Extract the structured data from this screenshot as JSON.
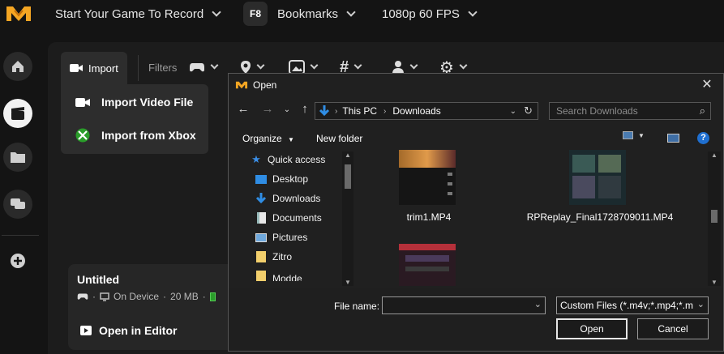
{
  "topbar": {
    "game_selector": "Start Your Game To Record",
    "hotkey": "F8",
    "bookmarks": "Bookmarks",
    "quality": "1080p 60 FPS"
  },
  "toolbar": {
    "import_label": "Import",
    "filters_label": "Filters"
  },
  "import_menu": {
    "items": [
      {
        "label": "Import Video File"
      },
      {
        "label": "Import from Xbox"
      }
    ]
  },
  "card": {
    "title": "Untitled",
    "location": "On Device",
    "size": "20 MB",
    "open_label": "Open in Editor"
  },
  "dialog": {
    "title": "Open",
    "close": "✕",
    "path": [
      "This PC",
      "Downloads"
    ],
    "search_placeholder": "Search Downloads",
    "organize_label": "Organize",
    "new_folder_label": "New folder",
    "sidebar": [
      {
        "label": "Quick access",
        "icon": "star-icon"
      },
      {
        "label": "Desktop",
        "icon": "desktop-icon",
        "pinned": true
      },
      {
        "label": "Downloads",
        "icon": "download-icon",
        "pinned": true
      },
      {
        "label": "Documents",
        "icon": "documents-icon",
        "pinned": true
      },
      {
        "label": "Pictures",
        "icon": "pictures-icon",
        "pinned": true
      },
      {
        "label": "Zitro",
        "icon": "folder-icon",
        "pinned": true
      },
      {
        "label": "Modde",
        "icon": "folder-icon",
        "pinned": true
      }
    ],
    "files": [
      {
        "name": "trim1.MP4"
      },
      {
        "name": "RPReplay_Final1728709011.MP4"
      }
    ],
    "file_name_label": "File name:",
    "file_name_value": "",
    "filter_value": "Custom Files (*.m4v;*.mp4;*.m",
    "open_button": "Open",
    "cancel_button": "Cancel"
  },
  "colors": {
    "accent_logo": "#f5a623",
    "xbox_green": "#2a9d2a",
    "folder_blue": "#2f8de4"
  }
}
